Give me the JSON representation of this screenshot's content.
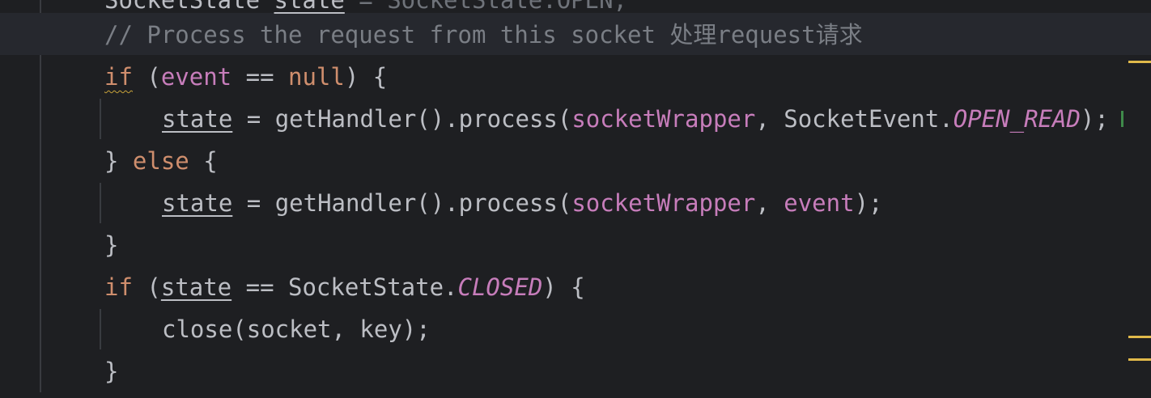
{
  "editor": {
    "lines": [
      {
        "id": "line-0",
        "tokens": [
          {
            "text": "SocketState ",
            "cls": "plain"
          },
          {
            "text": "state",
            "cls": "plain ul-var"
          },
          {
            "text": " = SocketState.OPEN;",
            "cls": "dimmed"
          }
        ]
      },
      {
        "id": "line-1",
        "tokens": [
          {
            "text": "// Process the request from this socket 处理request请求",
            "cls": "comment"
          }
        ]
      },
      {
        "id": "line-2",
        "tokens": [
          {
            "text": "if",
            "cls": "kw warn-ul"
          },
          {
            "text": " (",
            "cls": "plain"
          },
          {
            "text": "event",
            "cls": "field"
          },
          {
            "text": " == ",
            "cls": "plain"
          },
          {
            "text": "null",
            "cls": "kw"
          },
          {
            "text": ") {",
            "cls": "plain"
          }
        ]
      },
      {
        "id": "line-3",
        "tokens": [
          {
            "text": "state",
            "cls": "plain ul-var"
          },
          {
            "text": " = getHandler().process(",
            "cls": "plain"
          },
          {
            "text": "socketWrapper",
            "cls": "field"
          },
          {
            "text": ", SocketEvent.",
            "cls": "plain"
          },
          {
            "text": "OPEN_READ",
            "cls": "const"
          },
          {
            "text": ");",
            "cls": "plain"
          }
        ]
      },
      {
        "id": "line-4",
        "tokens": [
          {
            "text": "} ",
            "cls": "plain"
          },
          {
            "text": "else",
            "cls": "kw"
          },
          {
            "text": " {",
            "cls": "plain"
          }
        ]
      },
      {
        "id": "line-5",
        "tokens": [
          {
            "text": "state",
            "cls": "plain ul-var"
          },
          {
            "text": " = getHandler().process(",
            "cls": "plain"
          },
          {
            "text": "socketWrapper",
            "cls": "field"
          },
          {
            "text": ", ",
            "cls": "plain"
          },
          {
            "text": "event",
            "cls": "field"
          },
          {
            "text": ");",
            "cls": "plain"
          }
        ]
      },
      {
        "id": "line-6",
        "tokens": [
          {
            "text": "}",
            "cls": "plain"
          }
        ]
      },
      {
        "id": "line-7",
        "tokens": [
          {
            "text": "if",
            "cls": "kw"
          },
          {
            "text": " (",
            "cls": "plain"
          },
          {
            "text": "state",
            "cls": "plain ul-var"
          },
          {
            "text": " == SocketState.",
            "cls": "plain"
          },
          {
            "text": "CLOSED",
            "cls": "const"
          },
          {
            "text": ") {",
            "cls": "plain"
          }
        ]
      },
      {
        "id": "line-8",
        "tokens": [
          {
            "text": "close(socket, key);",
            "cls": "plain"
          }
        ]
      },
      {
        "id": "line-9",
        "tokens": [
          {
            "text": "}",
            "cls": "plain"
          }
        ]
      }
    ],
    "colors": {
      "background": "#1e1f22",
      "current_line": "#26282e",
      "keyword": "#cf8e6d",
      "field": "#c77dbb",
      "comment": "#7a7e85",
      "text": "#bcbec4",
      "marker": "#e0b94a"
    }
  }
}
